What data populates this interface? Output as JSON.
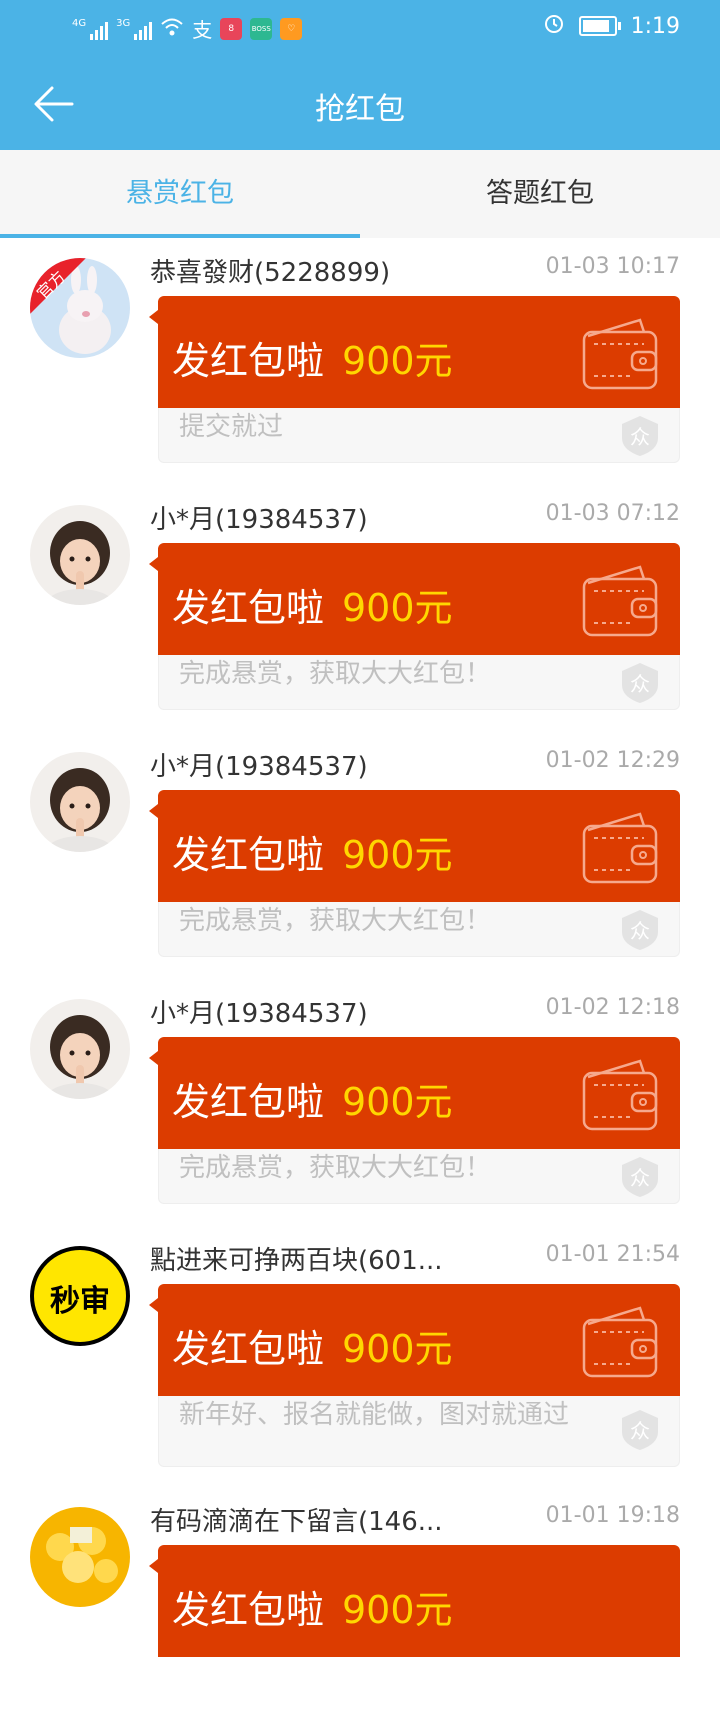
{
  "status": {
    "net1": "4G",
    "net2": "3G",
    "app_boss": "BOSS",
    "time": "1:19"
  },
  "header": {
    "title": "抢红包"
  },
  "tabs": [
    {
      "label": "悬赏红包",
      "active": true
    },
    {
      "label": "答题红包",
      "active": false
    }
  ],
  "items": [
    {
      "name": "恭喜發财(5228899)",
      "time": "01-03 10:17",
      "label": "发红包啦",
      "amount": "900元",
      "desc": "提交就过",
      "avatar": "official-bunny",
      "avatar_badge": "官方"
    },
    {
      "name": "小*月(19384537)",
      "time": "01-03 07:12",
      "label": "发红包啦",
      "amount": "900元",
      "desc": "完成悬赏，获取大大红包！",
      "avatar": "child-photo"
    },
    {
      "name": "小*月(19384537)",
      "time": "01-02 12:29",
      "label": "发红包啦",
      "amount": "900元",
      "desc": "完成悬赏，获取大大红包！",
      "avatar": "child-photo"
    },
    {
      "name": "小*月(19384537)",
      "time": "01-02 12:18",
      "label": "发红包啦",
      "amount": "900元",
      "desc": "完成悬赏，获取大大红包！",
      "avatar": "child-photo"
    },
    {
      "name": "點进来可挣两百块(601...",
      "time": "01-01 21:54",
      "label": "发红包啦",
      "amount": "900元",
      "desc": "新年好、报名就能做，图对就通过",
      "avatar": "miaoshen-logo",
      "avatar_text": "秒审"
    },
    {
      "name": "有码滴滴在下留言(146...",
      "time": "01-01 19:18",
      "label": "发红包啦",
      "amount": "900元",
      "desc": "",
      "avatar": "gold-coins"
    }
  ],
  "colors": {
    "primary": "#4bb3e6",
    "packet_red": "#dc3c00",
    "amount_yellow": "#ffd700"
  }
}
